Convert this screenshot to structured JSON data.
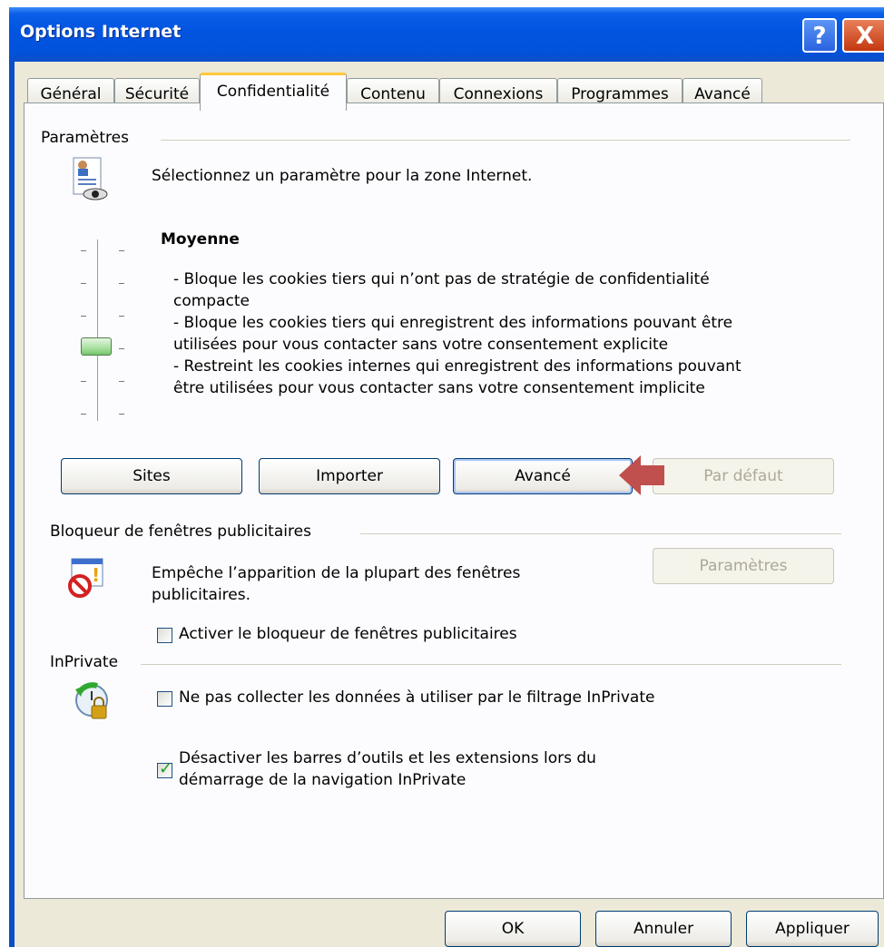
{
  "window": {
    "title": "Options Internet",
    "help_label": "?",
    "close_label": "X"
  },
  "tabs": [
    {
      "label": "Général"
    },
    {
      "label": "Sécurité"
    },
    {
      "label": "Confidentialité"
    },
    {
      "label": "Contenu"
    },
    {
      "label": "Connexions"
    },
    {
      "label": "Programmes"
    },
    {
      "label": "Avancé"
    }
  ],
  "settings": {
    "group_label": "Paramètres",
    "intro": "Sélectionnez un paramètre pour la zone Internet.",
    "level_title": "Moyenne",
    "level_lines": [
      "- Bloque les cookies tiers qui n’ont pas de stratégie de confidentialité",
      "compacte",
      "- Bloque les cookies tiers qui enregistrent des informations pouvant être",
      "utilisées pour vous contacter sans votre consentement explicite",
      "- Restreint les cookies internes qui enregistrent des informations pouvant",
      "être utilisées pour vous contacter sans votre consentement implicite"
    ],
    "buttons": {
      "sites": "Sites",
      "import": "Importer",
      "advanced": "Avancé",
      "default": "Par défaut"
    }
  },
  "popup_blocker": {
    "group_label": "Bloqueur de fenêtres publicitaires",
    "desc_line1": "Empêche l’apparition de la plupart des fenêtres",
    "desc_line2": "publicitaires.",
    "settings_button": "Paramètres",
    "enable_checkbox": {
      "label": "Activer le bloqueur de fenêtres publicitaires",
      "checked": false
    }
  },
  "inprivate": {
    "group_label": "InPrivate",
    "collect_checkbox": {
      "label": "Ne pas collecter les données à utiliser par le filtrage InPrivate",
      "checked": false
    },
    "disable_toolbars_checkbox": {
      "label_line1": "Désactiver les barres d’outils et les extensions lors du",
      "label_line2": "démarrage de la navigation InPrivate",
      "checked": true
    }
  },
  "footer": {
    "ok": "OK",
    "cancel": "Annuler",
    "apply": "Appliquer"
  },
  "colors": {
    "title_bar": "#0254e0",
    "dialog_bg": "#ece9d8",
    "panel_bg": "#fcfcfe",
    "active_tab_accent": "#ffc83c",
    "annotation_arrow": "#c0504d"
  },
  "icons": [
    "privacy-document-icon",
    "popup-blocker-icon",
    "inprivate-icon",
    "annotation-arrow-icon"
  ]
}
